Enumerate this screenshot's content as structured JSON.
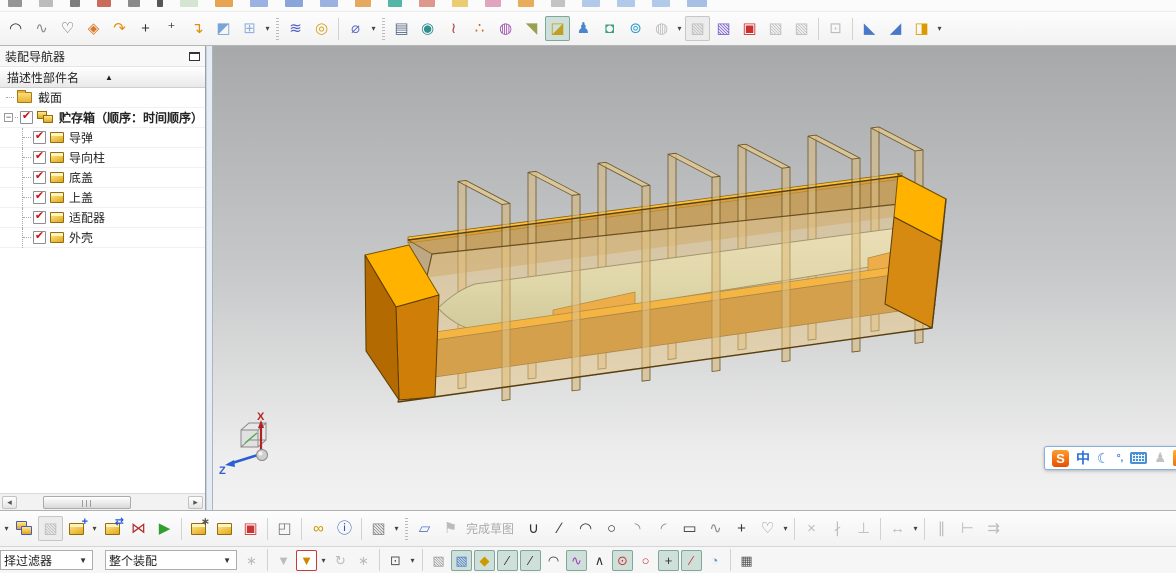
{
  "assembly_navigator": {
    "title": "装配导航器",
    "column_header": "描述性部件名",
    "sort_indicator": "▲",
    "tree": {
      "section": {
        "label": "截面"
      },
      "root": {
        "label": "贮存箱（顺序：时间顺序）",
        "checked": true,
        "expand_glyph": "−"
      },
      "children": [
        {
          "label": "导弹",
          "checked": true
        },
        {
          "label": "导向柱",
          "checked": true
        },
        {
          "label": "底盖",
          "checked": true
        },
        {
          "label": "上盖",
          "checked": true
        },
        {
          "label": "适配器",
          "checked": true
        },
        {
          "label": "外壳",
          "checked": true
        }
      ],
      "check_glyph": "✔"
    }
  },
  "viewport": {
    "triad": {
      "x_label": "X",
      "z_label": "Z",
      "x_color": "#cc2222",
      "z_color": "#2b5fd0"
    },
    "ime": {
      "logo": "S",
      "lang": "中",
      "punct": "°,"
    }
  },
  "sketch": {
    "finish_label": "完成草图"
  },
  "status_bar": {
    "type_filter": "择过滤器",
    "scope_filter": "整个装配"
  },
  "colors": {
    "model_bright": "#ffb300",
    "model_mid": "#d78a12",
    "model_dark": "#b36a00",
    "model_glass": "rgba(233,199,132,0.5)",
    "missile_light": "#eaf3e5",
    "missile_dark": "#c2d4bb",
    "check_red": "#cc1111",
    "snap_active_bg": "#cfe0da"
  },
  "top_partial_fragments": [
    {
      "n": "partial-curve",
      "c": "#8a8a8a",
      "w": 14
    },
    {
      "n": "partial-spline",
      "c": "#b5b5b5",
      "w": 14
    },
    {
      "n": "partial-line",
      "c": "#6f6f6f",
      "w": 10
    },
    {
      "n": "partial-arc-red",
      "c": "#c65b4a",
      "w": 14
    },
    {
      "n": "partial-curve-2",
      "c": "#7d7d7d",
      "w": 12
    },
    {
      "n": "partial-dropdown",
      "c": "#444444",
      "w": 6
    },
    {
      "n": "partial-plane-green",
      "c": "#cfe2cc",
      "w": 18
    },
    {
      "n": "partial-orange-cubes",
      "c": "#e59a40",
      "w": 18
    },
    {
      "n": "partial-blue-cube",
      "c": "#8fa8de",
      "w": 18
    },
    {
      "n": "partial-blue-cube-2",
      "c": "#7d9ad8",
      "w": 18
    },
    {
      "n": "partial-blue-cube-3",
      "c": "#8fa8de",
      "w": 18
    },
    {
      "n": "partial-orange-tool",
      "c": "#e0a050",
      "w": 16
    },
    {
      "n": "partial-teal-square",
      "c": "#3fae9e",
      "w": 14
    },
    {
      "n": "partial-red-frame",
      "c": "#d98c80",
      "w": 16
    },
    {
      "n": "partial-yellow-cube",
      "c": "#e8c860",
      "w": 16
    },
    {
      "n": "partial-pink-balls",
      "c": "#dd9ab8",
      "w": 16
    },
    {
      "n": "partial-orange-sheet",
      "c": "#e6a348",
      "w": 16
    },
    {
      "n": "partial-gray-sheet",
      "c": "#bdbdbd",
      "w": 14
    },
    {
      "n": "partial-lightblue-plane",
      "c": "#a9c4e8",
      "w": 18
    },
    {
      "n": "partial-lightblue-plane-2",
      "c": "#a9c4e8",
      "w": 18
    },
    {
      "n": "partial-lightblue-plane-3",
      "c": "#a9c4e8",
      "w": 18
    },
    {
      "n": "partial-multiplane",
      "c": "#9db8e2",
      "w": 20
    }
  ],
  "toolbars": {
    "top_main": [
      {
        "n": "arc-through-points",
        "g": "◠",
        "c": "#333333"
      },
      {
        "n": "studio-spline",
        "g": "∿",
        "c": "#8a8a8a"
      },
      {
        "n": "profile-curve",
        "g": "♡",
        "c": "#555555"
      },
      {
        "n": "swept-surface",
        "g": "◈",
        "c": "#d97b2a"
      },
      {
        "n": "project-curve",
        "g": "↷",
        "c": "#e09010"
      },
      {
        "n": "point",
        "g": "+",
        "c": "#333333"
      },
      {
        "n": "point-set",
        "g": "⁺",
        "c": "#333333"
      },
      {
        "n": "combined-projection",
        "g": "↴",
        "c": "#e09010"
      },
      {
        "n": "section-surface",
        "g": "◩",
        "c": "#7aa4d6"
      },
      {
        "n": "intersection-curve",
        "g": "⊞",
        "c": "#8fb2de",
        "dd": true
      },
      {
        "sep": true,
        "dotted": true
      },
      {
        "n": "helix",
        "g": "≋",
        "c": "#4a5fc0"
      },
      {
        "n": "coil",
        "g": "◎",
        "c": "#d4a017"
      },
      {
        "sep": true
      },
      {
        "n": "delete-spring",
        "g": "⌀",
        "c": "#5b6cc9",
        "dd": true
      },
      {
        "sep": true,
        "dotted": true
      },
      {
        "n": "animation-editor",
        "g": "▤",
        "c": "#5a6a8a"
      },
      {
        "n": "photo-render",
        "g": "◉",
        "c": "#2e8f8f"
      },
      {
        "n": "art-brush",
        "g": "≀",
        "c": "#b54040"
      },
      {
        "n": "material-colors",
        "g": "∴",
        "c": "#cc6010"
      },
      {
        "n": "material-ring",
        "g": "◍",
        "c": "#a050b0"
      },
      {
        "n": "spotlight",
        "g": "◥",
        "c": "#9aa050"
      },
      {
        "n": "basic-light",
        "g": "◪",
        "c": "#c0a020",
        "on": true
      },
      {
        "n": "actor-person",
        "g": "♟",
        "c": "#4a86cc"
      },
      {
        "n": "scene-materials",
        "g": "◘",
        "c": "#3aa080"
      },
      {
        "n": "system-palette",
        "g": "⊚",
        "c": "#2f9fd0"
      },
      {
        "n": "visual-effect",
        "g": "◍",
        "dis": true,
        "dd": true
      },
      {
        "n": "gray-cubes",
        "g": "▧",
        "dis": true,
        "frame": true
      },
      {
        "n": "true-shading",
        "g": "▧",
        "c": "#7a5fd0"
      },
      {
        "n": "image-background",
        "g": "▣",
        "c": "#cc3030"
      },
      {
        "n": "ray-traced-editor",
        "g": "▧",
        "dis": true
      },
      {
        "n": "ray-traced-display",
        "g": "▧",
        "dis": true
      },
      {
        "sep": true
      },
      {
        "n": "capture-region",
        "g": "⊡",
        "dis": true
      },
      {
        "sep": true
      },
      {
        "n": "extrude-wedge",
        "g": "◣",
        "c": "#4a78c8"
      },
      {
        "n": "revolve-wedge",
        "g": "◢",
        "c": "#4a78c8"
      },
      {
        "n": "sheet-operations",
        "g": "◨",
        "c": "#dd9900",
        "dd": true
      }
    ],
    "bottom_assembly": [
      {
        "n": "more-assembly-options",
        "ddonly": true
      },
      {
        "n": "find-component",
        "cubes": true
      },
      {
        "n": "assembly-constraints",
        "g": "▧",
        "dis": true,
        "frame": true
      },
      {
        "n": "add-component",
        "cube": true,
        "ov": "+",
        "oc": "#2255dd",
        "dd": true
      },
      {
        "n": "move-component",
        "cube": true,
        "ov": "⇄",
        "oc": "#2255dd"
      },
      {
        "n": "mirror-assembly",
        "g": "⋈",
        "c": "#b03030"
      },
      {
        "n": "assembly-sequence",
        "g": "▶",
        "c": "#2f9f2f"
      },
      {
        "sep": true
      },
      {
        "n": "replace-component",
        "cube": true,
        "ov": "∗",
        "oc": "#555555"
      },
      {
        "n": "pattern-component",
        "cube": true
      },
      {
        "n": "suppress-component",
        "g": "▣",
        "c": "#cc3333"
      },
      {
        "sep": true
      },
      {
        "n": "exploded-views",
        "g": "◰",
        "c": "#777777"
      },
      {
        "sep": true
      },
      {
        "n": "wave-geometry-link",
        "g": "∞",
        "c": "#cc9900"
      },
      {
        "n": "interpart-link-info",
        "g": "ⓘ",
        "c": "#3355bb"
      },
      {
        "sep": true
      },
      {
        "n": "display-mode-cube",
        "g": "▧",
        "c": "#888888",
        "dd": true
      },
      {
        "sep": true,
        "dotted": true
      },
      {
        "n": "sketch-in-task-env",
        "g": "▱",
        "c": "#4a78c8"
      },
      {
        "n": "finish-sketch-flag",
        "g": "⚑",
        "dis": true
      },
      {
        "label": "finish"
      },
      {
        "n": "fit-curve",
        "g": "∪",
        "c": "#333333"
      },
      {
        "n": "sketch-line",
        "g": "∕",
        "c": "#333333"
      },
      {
        "n": "sketch-arc",
        "g": "◠",
        "c": "#333333"
      },
      {
        "n": "sketch-circle",
        "g": "○",
        "c": "#333333"
      },
      {
        "n": "sketch-fillet",
        "g": "◝",
        "c": "#888888"
      },
      {
        "n": "sketch-chamfer",
        "g": "◜",
        "c": "#888888"
      },
      {
        "n": "sketch-rectangle",
        "g": "▭",
        "c": "#333333"
      },
      {
        "n": "sketch-spline",
        "g": "∿",
        "c": "#8a8a8a"
      },
      {
        "n": "sketch-point",
        "g": "+",
        "c": "#333333"
      },
      {
        "n": "sketch-profile",
        "g": "♡",
        "c": "#8a8a8a",
        "dd": true
      },
      {
        "sep": true
      },
      {
        "n": "quick-trim",
        "g": "×",
        "dis": true
      },
      {
        "n": "quick-extend",
        "g": "∤",
        "dis": true
      },
      {
        "n": "make-corner",
        "g": "⊥",
        "dis": true
      },
      {
        "sep": true
      },
      {
        "n": "inferred-dimension",
        "g": "↔",
        "dis": true,
        "dd": true
      },
      {
        "sep": true
      },
      {
        "n": "parallel-constraint",
        "g": "∥",
        "dis": true
      },
      {
        "n": "geometric-constraints",
        "g": "⊢",
        "dis": true
      },
      {
        "n": "auto-dimension",
        "g": "⇉",
        "dis": true
      }
    ],
    "bottom_snap": [
      {
        "n": "interpart-navigator",
        "g": "∗",
        "dis": true
      },
      {
        "sep": true
      },
      {
        "n": "filter-gray",
        "g": "▼",
        "dis": true
      },
      {
        "n": "general-selection-filter",
        "g": "▼",
        "c": "#cc8800",
        "redframe": true,
        "dd": true
      },
      {
        "n": "reset-orientation",
        "g": "↻",
        "dis": true
      },
      {
        "n": "filter-misc",
        "g": "∗",
        "dis": true
      },
      {
        "sep": true
      },
      {
        "n": "rectangle-select",
        "g": "⊡",
        "c": "#555555",
        "dd": true
      },
      {
        "sep": true
      },
      {
        "n": "shaded-view-cube",
        "g": "▧",
        "c": "#999999"
      },
      {
        "n": "wireframe-view-cube",
        "g": "▧",
        "c": "#4a78c8",
        "on": true
      },
      {
        "n": "snap-point-toggle",
        "g": "◆",
        "c": "#cc9900",
        "on": true
      },
      {
        "n": "snap-endpoint",
        "g": "∕",
        "c": "#333333",
        "on": true
      },
      {
        "n": "snap-midpoint",
        "g": "∕",
        "c": "#333333",
        "on": true
      },
      {
        "n": "snap-control-point",
        "g": "◠",
        "c": "#333333"
      },
      {
        "n": "snap-intersection",
        "g": "∿",
        "c": "#9a40c0",
        "on": true
      },
      {
        "n": "snap-arc-vertex",
        "g": "∧",
        "c": "#333333"
      },
      {
        "n": "snap-arc-center",
        "g": "⊙",
        "c": "#cc3333",
        "on": true
      },
      {
        "n": "snap-quadrant-point",
        "g": "○",
        "c": "#cc3333"
      },
      {
        "n": "snap-existing-point",
        "g": "+",
        "c": "#333333",
        "on": true
      },
      {
        "n": "snap-point-on-curve",
        "g": "∕",
        "c": "#cc3333",
        "on": true
      },
      {
        "n": "snap-point-on-face",
        "g": "◔",
        "c": "#6699cc"
      },
      {
        "sep": true
      },
      {
        "n": "grid-point",
        "g": "▦",
        "c": "#555555"
      }
    ]
  }
}
